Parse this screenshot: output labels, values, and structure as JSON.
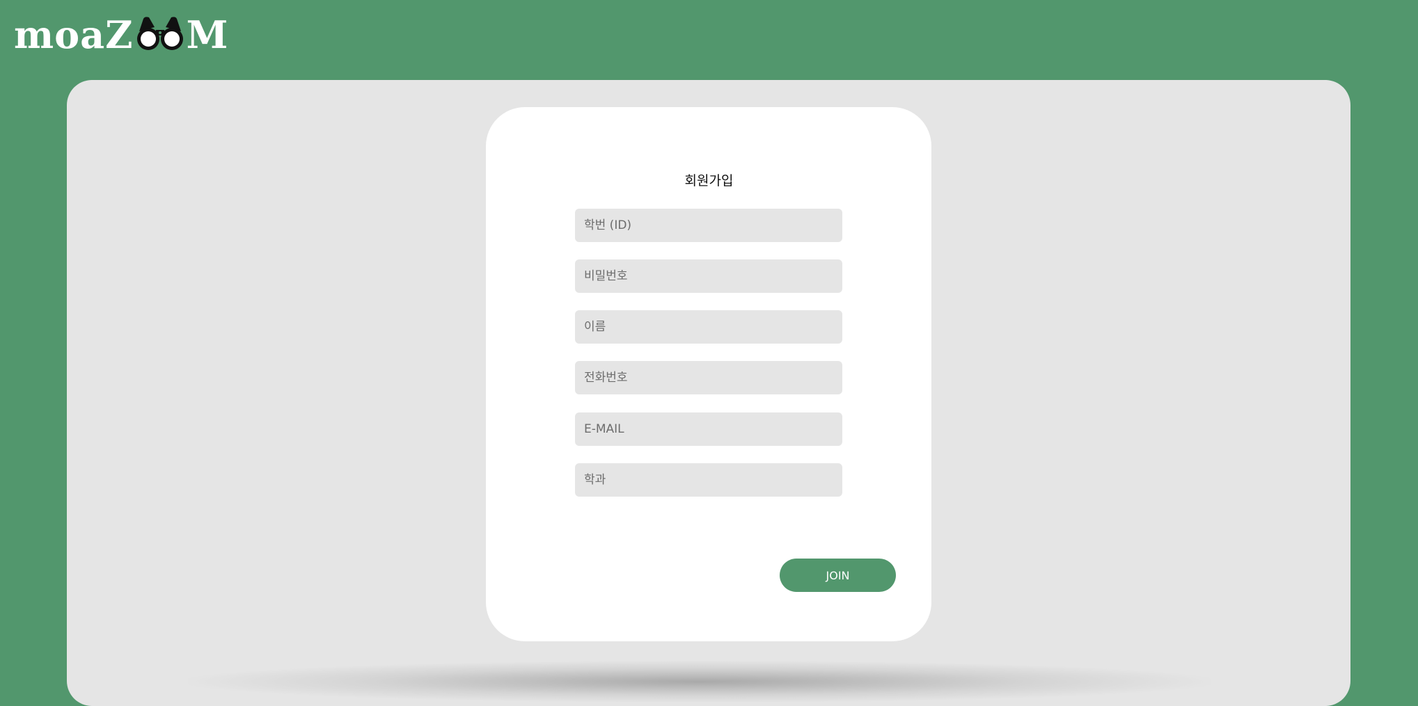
{
  "header": {
    "logo_prefix": "moaZ",
    "logo_suffix": "M",
    "logo_icon": "binoculars-icon"
  },
  "signup": {
    "title": "회원가입",
    "fields": {
      "student_id": {
        "placeholder": "학번 (ID)",
        "value": ""
      },
      "password": {
        "placeholder": "비밀번호",
        "value": ""
      },
      "name": {
        "placeholder": "이름",
        "value": ""
      },
      "phone": {
        "placeholder": "전화번호",
        "value": ""
      },
      "email": {
        "placeholder": "E-MAIL",
        "value": ""
      },
      "department": {
        "placeholder": "학과",
        "value": ""
      }
    },
    "join_label": "JOIN"
  },
  "colors": {
    "brand_green": "#52976d",
    "panel_gray": "#e5e5e5",
    "card_white": "#ffffff"
  }
}
